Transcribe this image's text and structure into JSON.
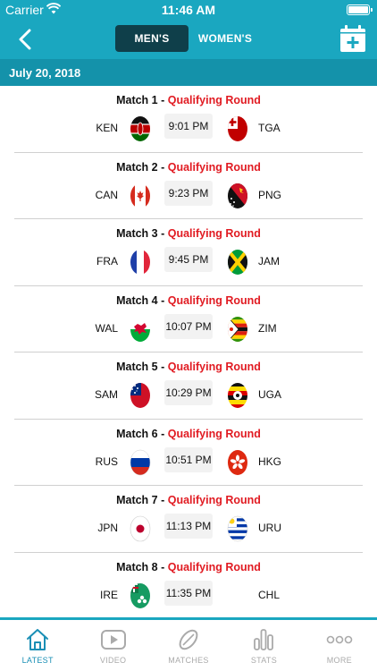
{
  "status_bar": {
    "carrier": "Carrier",
    "time": "11:46 AM"
  },
  "nav": {
    "segments": [
      {
        "label": "MEN'S",
        "active": true
      },
      {
        "label": "WOMEN'S",
        "active": false
      }
    ]
  },
  "date_header": "July 20, 2018",
  "matches": [
    {
      "title": "Match 1 - ",
      "round": "Qualifying Round",
      "home": "KEN",
      "time": "9:01 PM",
      "away": "TGA"
    },
    {
      "title": "Match 2 - ",
      "round": "Qualifying Round",
      "home": "CAN",
      "time": "9:23 PM",
      "away": "PNG"
    },
    {
      "title": "Match 3 - ",
      "round": "Qualifying Round",
      "home": "FRA",
      "time": "9:45 PM",
      "away": "JAM"
    },
    {
      "title": "Match 4 - ",
      "round": "Qualifying Round",
      "home": "WAL",
      "time": "10:07 PM",
      "away": "ZIM"
    },
    {
      "title": "Match 5 - ",
      "round": "Qualifying Round",
      "home": "SAM",
      "time": "10:29 PM",
      "away": "UGA"
    },
    {
      "title": "Match 6 - ",
      "round": "Qualifying Round",
      "home": "RUS",
      "time": "10:51 PM",
      "away": "HKG"
    },
    {
      "title": "Match 7 - ",
      "round": "Qualifying Round",
      "home": "JPN",
      "time": "11:13 PM",
      "away": "URU"
    },
    {
      "title": "Match 8 - ",
      "round": "Qualifying Round",
      "home": "IRE",
      "time": "11:35 PM",
      "away": "CHL"
    }
  ],
  "tabs": [
    {
      "label": "LATEST",
      "icon": "home-icon",
      "active": true
    },
    {
      "label": "VIDEO",
      "icon": "play-icon",
      "active": false
    },
    {
      "label": "MATCHES",
      "icon": "rugby-ball-icon",
      "active": false
    },
    {
      "label": "STATS",
      "icon": "bar-chart-icon",
      "active": false
    },
    {
      "label": "MORE",
      "icon": "more-icon",
      "active": false
    }
  ],
  "colors": {
    "primary": "#1aa7c0",
    "date_bar": "#1492aa",
    "segment_active": "#0f3f4a",
    "round_red": "#e11b22",
    "tab_active": "#1a8fb5",
    "tab_inactive": "#aaaaaa"
  }
}
